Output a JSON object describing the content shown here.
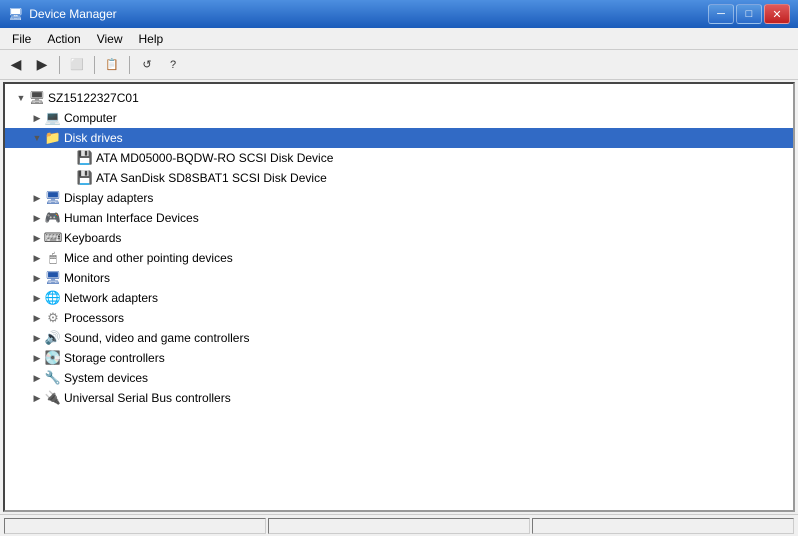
{
  "window": {
    "title": "Device Manager",
    "icon": "🖥"
  },
  "titlebar": {
    "controls": {
      "minimize": "─",
      "maximize": "□",
      "close": "✕"
    }
  },
  "menubar": {
    "items": [
      {
        "id": "file",
        "label": "File"
      },
      {
        "id": "action",
        "label": "Action"
      },
      {
        "id": "view",
        "label": "View"
      },
      {
        "id": "help",
        "label": "Help"
      }
    ]
  },
  "toolbar": {
    "buttons": [
      {
        "id": "back",
        "icon": "◀",
        "label": "Back"
      },
      {
        "id": "forward",
        "icon": "▶",
        "label": "Forward"
      },
      {
        "id": "up",
        "icon": "⬜",
        "label": "Up"
      },
      {
        "id": "sep1",
        "type": "separator"
      },
      {
        "id": "properties",
        "icon": "📋",
        "label": "Properties"
      },
      {
        "id": "sep2",
        "type": "separator"
      },
      {
        "id": "refresh",
        "icon": "🔄",
        "label": "Refresh"
      }
    ]
  },
  "tree": {
    "items": [
      {
        "id": "root",
        "label": "SZ15122327C01",
        "indent": 1,
        "expanded": true,
        "hasToggle": true,
        "toggleChar": "▼",
        "icon": "🖥",
        "iconClass": "icon-computer"
      },
      {
        "id": "computer",
        "label": "Computer",
        "indent": 2,
        "expanded": false,
        "hasToggle": true,
        "toggleChar": "▶",
        "icon": "💻",
        "iconClass": "icon-computer"
      },
      {
        "id": "disk-drives",
        "label": "Disk drives",
        "indent": 2,
        "expanded": true,
        "hasToggle": true,
        "toggleChar": "▼",
        "icon": "📁",
        "iconClass": "icon-disk",
        "selected": true
      },
      {
        "id": "disk1",
        "label": "ATA MD05000-BQDW-RO SCSI Disk Device",
        "indent": 4,
        "expanded": false,
        "hasToggle": false,
        "icon": "💾",
        "iconClass": "icon-drive"
      },
      {
        "id": "disk2",
        "label": "ATA SanDisk SD8SBAT1 SCSI Disk Device",
        "indent": 4,
        "expanded": false,
        "hasToggle": false,
        "icon": "💾",
        "iconClass": "icon-drive"
      },
      {
        "id": "display",
        "label": "Display adapters",
        "indent": 2,
        "expanded": false,
        "hasToggle": true,
        "toggleChar": "▶",
        "icon": "🖥",
        "iconClass": "icon-display"
      },
      {
        "id": "hid",
        "label": "Human Interface Devices",
        "indent": 2,
        "expanded": false,
        "hasToggle": true,
        "toggleChar": "▶",
        "icon": "🎮",
        "iconClass": "icon-hid"
      },
      {
        "id": "keyboard",
        "label": "Keyboards",
        "indent": 2,
        "expanded": false,
        "hasToggle": true,
        "toggleChar": "▶",
        "icon": "⌨",
        "iconClass": "icon-keyboard"
      },
      {
        "id": "mice",
        "label": "Mice and other pointing devices",
        "indent": 2,
        "expanded": false,
        "hasToggle": true,
        "toggleChar": "▶",
        "icon": "🖱",
        "iconClass": "icon-mouse"
      },
      {
        "id": "monitors",
        "label": "Monitors",
        "indent": 2,
        "expanded": false,
        "hasToggle": true,
        "toggleChar": "▶",
        "icon": "🖥",
        "iconClass": "icon-monitor"
      },
      {
        "id": "network",
        "label": "Network adapters",
        "indent": 2,
        "expanded": false,
        "hasToggle": true,
        "toggleChar": "▶",
        "icon": "🌐",
        "iconClass": "icon-network"
      },
      {
        "id": "processors",
        "label": "Processors",
        "indent": 2,
        "expanded": false,
        "hasToggle": true,
        "toggleChar": "▶",
        "icon": "⚙",
        "iconClass": "icon-cpu"
      },
      {
        "id": "sound",
        "label": "Sound, video and game controllers",
        "indent": 2,
        "expanded": false,
        "hasToggle": true,
        "toggleChar": "▶",
        "icon": "🔊",
        "iconClass": "icon-sound"
      },
      {
        "id": "storage",
        "label": "Storage controllers",
        "indent": 2,
        "expanded": false,
        "hasToggle": true,
        "toggleChar": "▶",
        "icon": "💽",
        "iconClass": "icon-storage"
      },
      {
        "id": "system",
        "label": "System devices",
        "indent": 2,
        "expanded": false,
        "hasToggle": true,
        "toggleChar": "▶",
        "icon": "🔧",
        "iconClass": "icon-system"
      },
      {
        "id": "usb",
        "label": "Universal Serial Bus controllers",
        "indent": 2,
        "expanded": false,
        "hasToggle": true,
        "toggleChar": "▶",
        "icon": "🔌",
        "iconClass": "icon-usb"
      }
    ]
  },
  "statusbar": {
    "panes": [
      "",
      "",
      ""
    ]
  }
}
